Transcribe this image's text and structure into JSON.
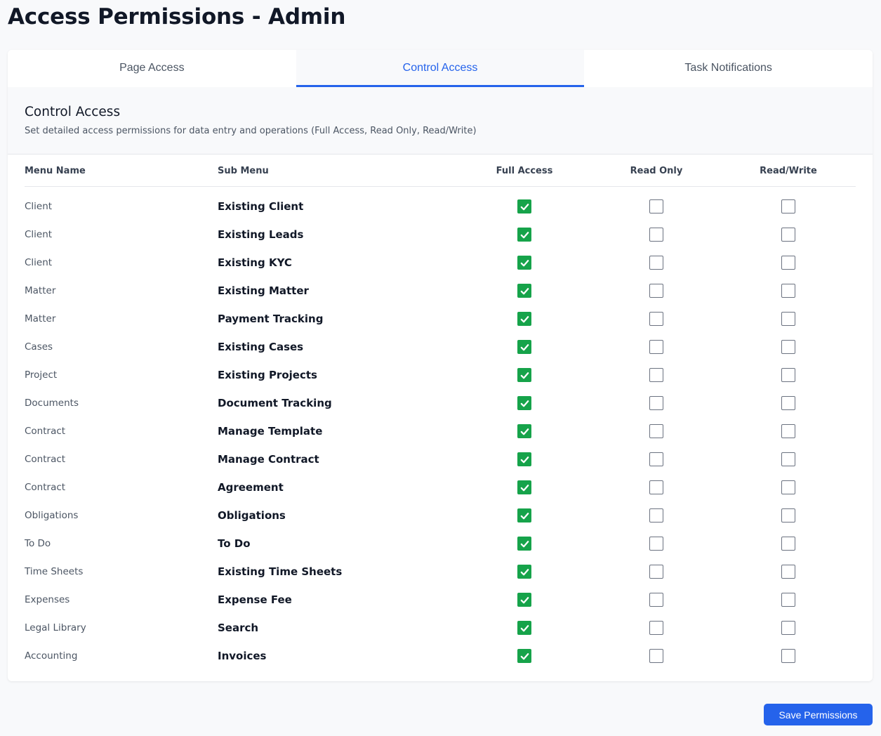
{
  "page": {
    "title": "Access Permissions - Admin"
  },
  "tabs": [
    {
      "label": "Page Access",
      "active": false
    },
    {
      "label": "Control Access",
      "active": true
    },
    {
      "label": "Task Notifications",
      "active": false
    }
  ],
  "section": {
    "title": "Control Access",
    "description": "Set detailed access permissions for data entry and operations (Full Access, Read Only, Read/Write)"
  },
  "table": {
    "columns": [
      "Menu Name",
      "Sub Menu",
      "Full Access",
      "Read Only",
      "Read/Write"
    ],
    "rows": [
      {
        "menu": "Client",
        "sub": "Existing Client",
        "full": true,
        "read_only": false,
        "read_write": false
      },
      {
        "menu": "Client",
        "sub": "Existing Leads",
        "full": true,
        "read_only": false,
        "read_write": false
      },
      {
        "menu": "Client",
        "sub": "Existing KYC",
        "full": true,
        "read_only": false,
        "read_write": false
      },
      {
        "menu": "Matter",
        "sub": "Existing Matter",
        "full": true,
        "read_only": false,
        "read_write": false
      },
      {
        "menu": "Matter",
        "sub": "Payment Tracking",
        "full": true,
        "read_only": false,
        "read_write": false
      },
      {
        "menu": "Cases",
        "sub": "Existing Cases",
        "full": true,
        "read_only": false,
        "read_write": false
      },
      {
        "menu": "Project",
        "sub": "Existing Projects",
        "full": true,
        "read_only": false,
        "read_write": false
      },
      {
        "menu": "Documents",
        "sub": "Document Tracking",
        "full": true,
        "read_only": false,
        "read_write": false
      },
      {
        "menu": "Contract",
        "sub": "Manage Template",
        "full": true,
        "read_only": false,
        "read_write": false
      },
      {
        "menu": "Contract",
        "sub": "Manage Contract",
        "full": true,
        "read_only": false,
        "read_write": false
      },
      {
        "menu": "Contract",
        "sub": "Agreement",
        "full": true,
        "read_only": false,
        "read_write": false
      },
      {
        "menu": "Obligations",
        "sub": "Obligations",
        "full": true,
        "read_only": false,
        "read_write": false
      },
      {
        "menu": "To Do",
        "sub": "To Do",
        "full": true,
        "read_only": false,
        "read_write": false
      },
      {
        "menu": "Time Sheets",
        "sub": "Existing Time Sheets",
        "full": true,
        "read_only": false,
        "read_write": false
      },
      {
        "menu": "Expenses",
        "sub": "Expense Fee",
        "full": true,
        "read_only": false,
        "read_write": false
      },
      {
        "menu": "Legal Library",
        "sub": "Search",
        "full": true,
        "read_only": false,
        "read_write": false
      },
      {
        "menu": "Accounting",
        "sub": "Invoices",
        "full": true,
        "read_only": false,
        "read_write": false
      }
    ]
  },
  "actions": {
    "save_label": "Save Permissions"
  },
  "colors": {
    "accent": "#2563eb",
    "checked": "#16a34a"
  }
}
